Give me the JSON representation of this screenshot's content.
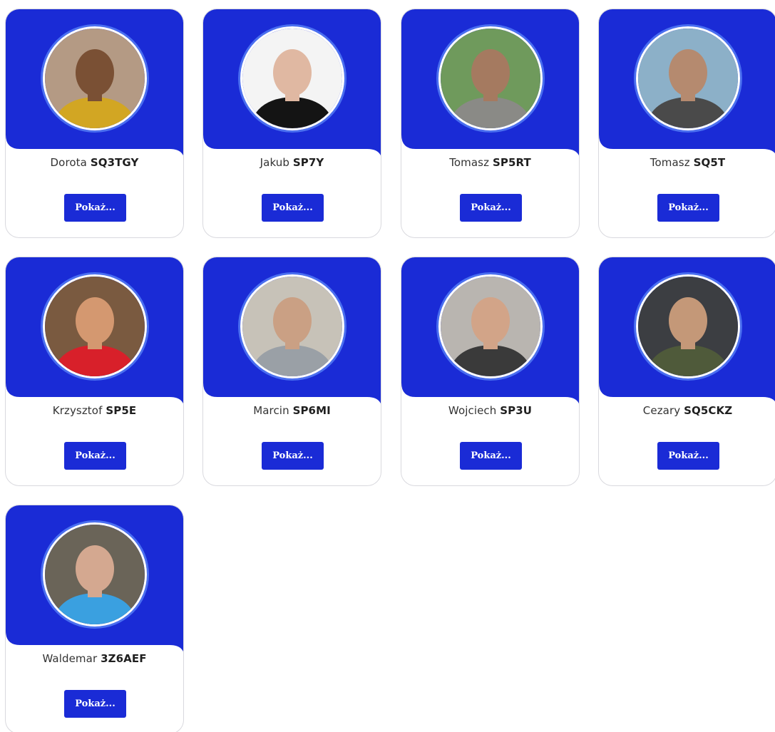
{
  "accent_color": "#1a2bd6",
  "button_label": "Pokaż...",
  "members": [
    {
      "first_name": "Dorota",
      "callsign": "SQ3TGY",
      "avatar_bg": "#b49a84",
      "avatar_fg": "#7a5034",
      "avatar_shirt": "#d2a623"
    },
    {
      "first_name": "Jakub",
      "callsign": "SP7Y",
      "avatar_bg": "#f4f4f4",
      "avatar_fg": "#e0b8a2",
      "avatar_shirt": "#141414"
    },
    {
      "first_name": "Tomasz",
      "callsign": "SP5RT",
      "avatar_bg": "#6f9a5c",
      "avatar_fg": "#a57a60",
      "avatar_shirt": "#8a8a86"
    },
    {
      "first_name": "Tomasz",
      "callsign": "SQ5T",
      "avatar_bg": "#8cb0c8",
      "avatar_fg": "#b58a6f",
      "avatar_shirt": "#4a4a4a"
    },
    {
      "first_name": "Krzysztof",
      "callsign": "SP5E",
      "avatar_bg": "#7a5a40",
      "avatar_fg": "#d49870",
      "avatar_shirt": "#d8202a"
    },
    {
      "first_name": "Marcin",
      "callsign": "SP6MI",
      "avatar_bg": "#c7c2b8",
      "avatar_fg": "#caa084",
      "avatar_shirt": "#9aa0a6"
    },
    {
      "first_name": "Wojciech",
      "callsign": "SP3U",
      "avatar_bg": "#b9b5b0",
      "avatar_fg": "#d2a488",
      "avatar_shirt": "#3a3a3a"
    },
    {
      "first_name": "Cezary",
      "callsign": "SQ5CKZ",
      "avatar_bg": "#3c3e42",
      "avatar_fg": "#c49878",
      "avatar_shirt": "#4f5a3a"
    },
    {
      "first_name": "Waldemar",
      "callsign": "3Z6AEF",
      "avatar_bg": "#6a6458",
      "avatar_fg": "#d4a890",
      "avatar_shirt": "#3aa0e0"
    }
  ]
}
